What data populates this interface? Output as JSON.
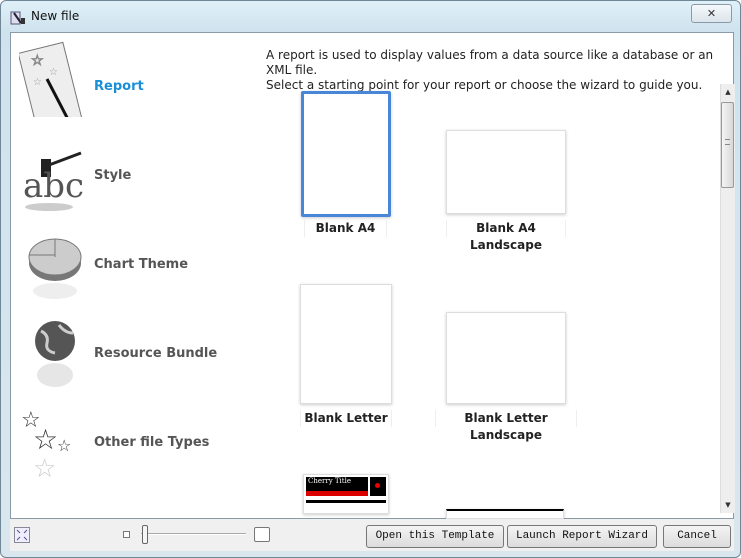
{
  "window": {
    "title": "New file",
    "close_icon": "close-icon"
  },
  "sidebar": {
    "items": [
      {
        "label": "Report",
        "icon": "report-wand-icon",
        "selected": true
      },
      {
        "label": "Style",
        "icon": "style-brush-icon"
      },
      {
        "label": "Chart Theme",
        "icon": "pie-chart-icon"
      },
      {
        "label": "Resource Bundle",
        "icon": "globe-icon"
      },
      {
        "label": "Other file Types",
        "icon": "stars-icon"
      }
    ]
  },
  "main": {
    "description": [
      "A report is used to display values from a data source like a database or an XML file.",
      "Select a starting point for your report or choose the wizard to guide you."
    ],
    "templates": [
      {
        "label": "Blank A4",
        "selected": true
      },
      {
        "label": "Blank A4 Landscape"
      },
      {
        "label": "Blank Letter"
      },
      {
        "label": "Blank Letter Landscape"
      }
    ],
    "cherry_preview_title": "Cherry Title"
  },
  "footer": {
    "open_label": "Open this Template",
    "wizard_label": "Launch Report Wizard",
    "cancel_label": "Cancel"
  }
}
